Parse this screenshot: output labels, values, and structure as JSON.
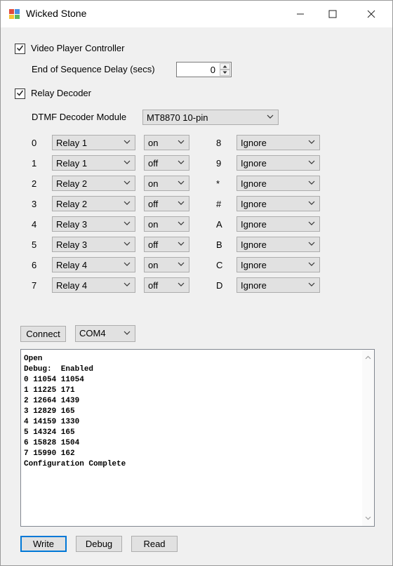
{
  "window": {
    "title": "Wicked Stone",
    "minimize_icon": "minimize-icon",
    "maximize_icon": "maximize-icon",
    "close_icon": "close-icon"
  },
  "video_player": {
    "checkbox_label": "Video Player Controller",
    "checked": true,
    "delay_label": "End of Sequence Delay (secs)",
    "delay_value": "0"
  },
  "relay_decoder": {
    "checkbox_label": "Relay Decoder",
    "checked": true,
    "module_label": "DTMF Decoder Module",
    "module_value": "MT8870 10-pin"
  },
  "left_rows": [
    {
      "digit": "0",
      "relay": "Relay 1",
      "state": "on"
    },
    {
      "digit": "1",
      "relay": "Relay 1",
      "state": "off"
    },
    {
      "digit": "2",
      "relay": "Relay 2",
      "state": "on"
    },
    {
      "digit": "3",
      "relay": "Relay 2",
      "state": "off"
    },
    {
      "digit": "4",
      "relay": "Relay 3",
      "state": "on"
    },
    {
      "digit": "5",
      "relay": "Relay 3",
      "state": "off"
    },
    {
      "digit": "6",
      "relay": "Relay 4",
      "state": "on"
    },
    {
      "digit": "7",
      "relay": "Relay 4",
      "state": "off"
    }
  ],
  "right_rows": [
    {
      "digit": "8",
      "action": "Ignore"
    },
    {
      "digit": "9",
      "action": "Ignore"
    },
    {
      "digit": "*",
      "action": "Ignore"
    },
    {
      "digit": "#",
      "action": "Ignore"
    },
    {
      "digit": "A",
      "action": "Ignore"
    },
    {
      "digit": "B",
      "action": "Ignore"
    },
    {
      "digit": "C",
      "action": "Ignore"
    },
    {
      "digit": "D",
      "action": "Ignore"
    }
  ],
  "connection": {
    "connect_label": "Connect",
    "port_value": "COM4"
  },
  "log": [
    "Open",
    "Debug:  Enabled",
    "0 11054 11054",
    "1 11225 171",
    "2 12664 1439",
    "3 12829 165",
    "4 14159 1330",
    "5 14324 165",
    "6 15828 1504",
    "7 15990 162",
    "Configuration Complete"
  ],
  "footer": {
    "write_label": "Write",
    "debug_label": "Debug",
    "read_label": "Read"
  }
}
